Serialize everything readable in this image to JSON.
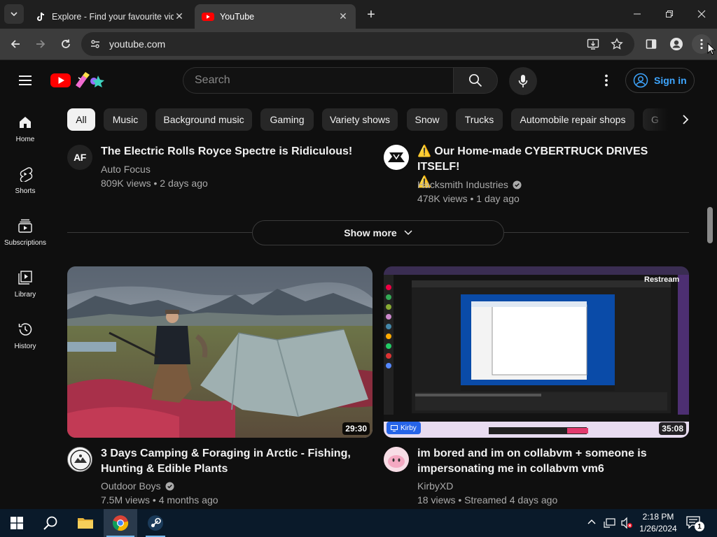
{
  "browser": {
    "tabs": [
      {
        "title": "Explore - Find your favourite videos on TikTok",
        "active": false,
        "icon": "tiktok-icon"
      },
      {
        "title": "YouTube",
        "active": true,
        "icon": "youtube-icon"
      }
    ],
    "url": "youtube.com"
  },
  "header": {
    "search_placeholder": "Search",
    "signin_label": "Sign in"
  },
  "guide": [
    {
      "label": "Home",
      "icon": "home-icon"
    },
    {
      "label": "Shorts",
      "icon": "shorts-icon"
    },
    {
      "label": "Subscriptions",
      "icon": "subscriptions-icon"
    },
    {
      "label": "Library",
      "icon": "library-icon"
    },
    {
      "label": "History",
      "icon": "history-icon"
    }
  ],
  "chips": [
    "All",
    "Music",
    "Background music",
    "Gaming",
    "Variety shows",
    "Snow",
    "Trucks",
    "Automobile repair shops",
    "G"
  ],
  "top_videos": [
    {
      "title": "The Electric Rolls Royce Spectre is Ridiculous!",
      "channel": "Auto Focus",
      "meta": "809K views • 2 days ago",
      "avatar_text": "AF"
    },
    {
      "title_line1": "⚠️ Our Home-made CYBERTRUCK DRIVES ITSELF!",
      "title_line2": "⚠️",
      "channel": "Hacksmith Industries",
      "meta": "478K views • 1 day ago",
      "verified": true
    }
  ],
  "show_more_label": "Show more",
  "videos": [
    {
      "title_line1": "3 Days Camping & Foraging in Arctic - Fishing,",
      "title_line2": "Hunting & Edible Plants",
      "channel": "Outdoor Boys",
      "meta": "7.5M views • 4 months ago",
      "duration": "29:30",
      "verified": true
    },
    {
      "title_line1": "im bored and im on collabvm + someone is",
      "title_line2": "impersonating me in collabvm vm6",
      "channel": "KirbyXD",
      "meta": "18 views • Streamed 4 days ago",
      "duration": "35:08",
      "thumb_overlay": "Restream",
      "thumb_badge": "Kirby"
    }
  ],
  "taskbar": {
    "time": "2:18 PM",
    "date": "1/26/2024",
    "notification_count": "1"
  },
  "colors": {
    "yt_red": "#ff0000",
    "link_blue": "#3ea6ff",
    "bg": "#0f0f0f"
  }
}
